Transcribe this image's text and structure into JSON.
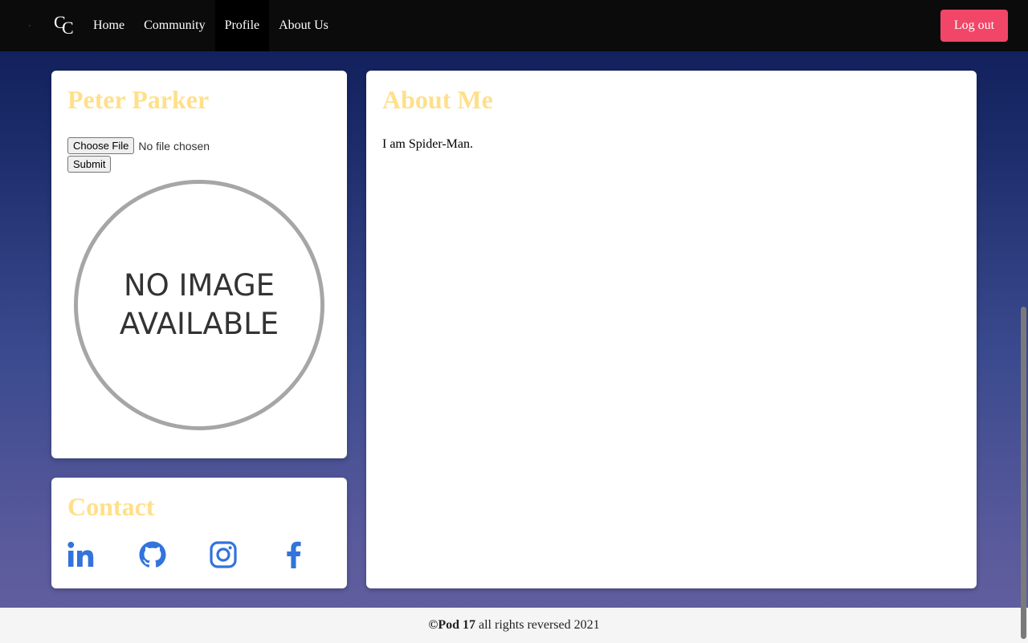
{
  "nav": {
    "logo_letters": [
      "C",
      "C"
    ],
    "links": [
      {
        "label": "Home",
        "active": false
      },
      {
        "label": "Community",
        "active": false
      },
      {
        "label": "Profile",
        "active": true
      },
      {
        "label": "About Us",
        "active": false
      }
    ],
    "logout_label": "Log out",
    "logout_color": "#f14668"
  },
  "profile": {
    "name": "Peter Parker",
    "title_color": "#ffe08a",
    "file_button": "Choose File",
    "file_status": "No file chosen",
    "submit_label": "Submit",
    "image_placeholder_line1": "NO IMAGE",
    "image_placeholder_line2": "AVAILABLE"
  },
  "contact": {
    "title": "Contact",
    "icons": [
      "linkedin-icon",
      "github-icon",
      "instagram-icon",
      "facebook-icon"
    ],
    "icon_color": "#3273dc"
  },
  "about": {
    "title": "About Me",
    "text": "I am Spider-Man."
  },
  "footer": {
    "brand": "©Pod 17",
    "text": " all rights reversed 2021"
  }
}
